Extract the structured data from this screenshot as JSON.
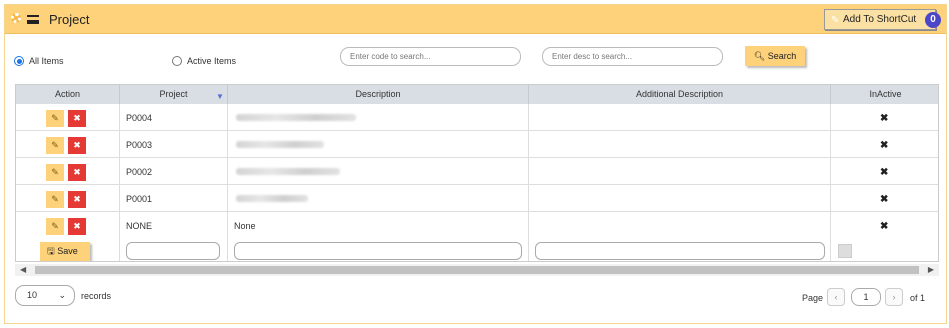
{
  "header": {
    "title": "Project",
    "shortcut_label": "Add To ShortCut",
    "shortcut_badge": "0"
  },
  "filters": {
    "all_items": "All Items",
    "active_items": "Active Items",
    "selected": "all_items",
    "code_placeholder": "Enter code to search...",
    "desc_placeholder": "Enter desc to search...",
    "search_button": "Search"
  },
  "table": {
    "columns": [
      "Action",
      "Project",
      "Description",
      "Additional Description",
      "InActive"
    ],
    "rows": [
      {
        "project": "P0004",
        "description": "",
        "description_blurred": true,
        "additional": "",
        "inactive": "✖"
      },
      {
        "project": "P0003",
        "description": "",
        "description_blurred": true,
        "additional": "",
        "inactive": "✖"
      },
      {
        "project": "P0002",
        "description": "",
        "description_blurred": true,
        "additional": "",
        "inactive": "✖"
      },
      {
        "project": "P0001",
        "description": "",
        "description_blurred": true,
        "additional": "",
        "inactive": "✖"
      },
      {
        "project": "NONE",
        "description": "None",
        "description_blurred": false,
        "additional": "",
        "inactive": "✖"
      }
    ],
    "save_button": "Save"
  },
  "pagination": {
    "page_size": "10",
    "records_label": "records",
    "page_label": "Page",
    "current_page": "1",
    "of_label": "of 1"
  },
  "colors": {
    "accent": "#fdd27a",
    "delete": "#e53935",
    "badge": "#4b47c8",
    "radio": "#1a73e8"
  }
}
